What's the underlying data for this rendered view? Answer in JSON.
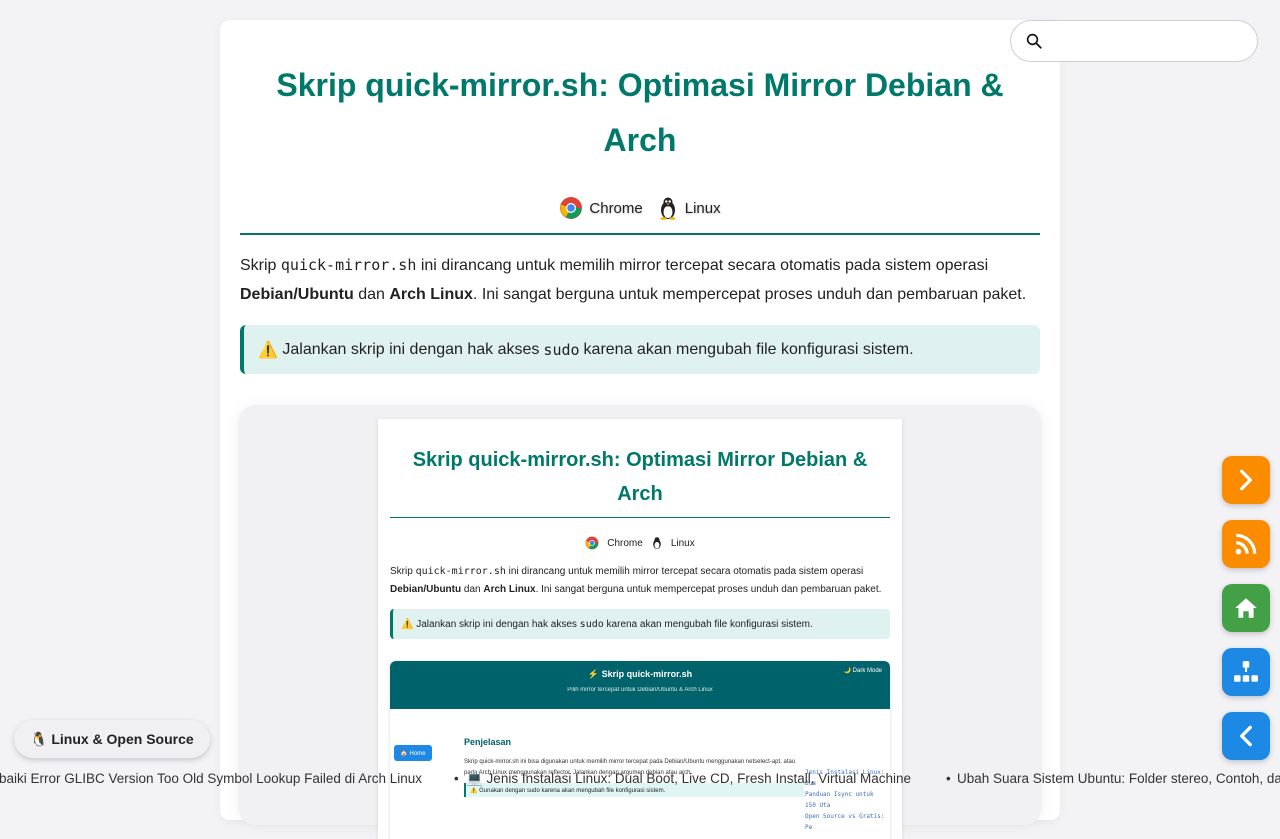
{
  "article": {
    "title": "Skrip quick-mirror.sh: Optimasi Mirror Debian & Arch",
    "platforms": [
      "Chrome",
      "Linux"
    ],
    "intro": {
      "p1": "Skrip ",
      "code": "quick-mirror.sh",
      "p2": " ini dirancang untuk memilih mirror tercepat secara otomatis pada sistem operasi ",
      "b1": "Debian/Ubuntu",
      "p3": " dan ",
      "b2": "Arch Linux",
      "p4": ". Ini sangat berguna untuk mempercepat proses unduh dan pembaruan paket."
    },
    "note": {
      "icon": "⚠️",
      "before": "Jalankan skrip ini dengan hak akses",
      "code": "sudo",
      "after": "karena akan mengubah file konfigurasi sistem."
    }
  },
  "preview": {
    "app_title": "⚡ Skrip quick-mirror.sh",
    "app_subtitle": "Pilih mirror tercepat untuk Debian/Ubuntu & Arch Linux",
    "dark_mode": "🌙 Dark Mode",
    "home": "🏠 Home",
    "section": "Penjelasan",
    "body_a": "Skrip quick-mirror.sh ini bisa digunakan untuk memilih mirror tercepat pada Debian/Ubuntu menggunakan netselect-apt, atau",
    "body_b": "pada Arch Linux menggunakan reflector. Jalankan dengan argumen debian atau arch.",
    "warn": "⚠️ Gunakan dengan sudo karena akan mengubah file konfigurasi sistem.",
    "side": [
      "Jenis Instalasi Linux: Dua",
      "Panduan Isync untuk 150 Uta",
      "Open Source vs Gratis: Pe"
    ]
  },
  "search": {
    "placeholder": ""
  },
  "tag": {
    "label": "🐧 Linux & Open Source"
  },
  "ticker": {
    "items": [
      "Perbaiki Error GLIBC Version Too Old Symbol Lookup Failed di Arch Linux",
      "💻 Jenis Instalasi Linux: Dual Boot, Live CD, Fresh Install, Virtual Machine",
      "Ubah Suara Sistem Ubuntu: Folder stereo, Contoh, dan"
    ]
  },
  "colors": {
    "accent": "#00796b",
    "orange": "#fb8c00",
    "green": "#43a047",
    "blue": "#1e88e5"
  },
  "icons": [
    "search-icon",
    "chrome-icon",
    "tux-icon",
    "chevron-right-icon",
    "rss-icon",
    "home-icon",
    "sitemap-icon",
    "chevron-left-icon"
  ]
}
